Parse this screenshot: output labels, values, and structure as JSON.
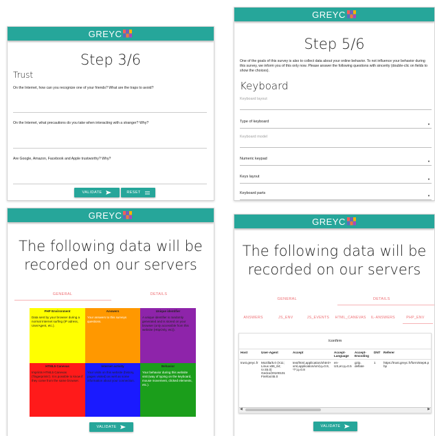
{
  "brand": {
    "name": "GREYC",
    "color": "#26a69a",
    "accent": "#ee6e73"
  },
  "p1": {
    "title": "Step 3/6",
    "section": "Trust",
    "q1": "On the Internet, how can you recognize one of your friends? What are the traps to avoid?",
    "q2": "On the Internet, what precautions do you take when interacting with a stranger? Why?",
    "q3": "Are Google, Amazon, Facebook and Apple trustworthy? Why?",
    "validate": "VALIDATE",
    "reset": "RESET"
  },
  "p2": {
    "title": "Step 5/6",
    "intro": "One of the goals of this survey is also to collect data about your online behavior. To not influence your behavior during this survey, we inform you of this only now. Please answer the following questions with sincerity (double-clic on fields to show the choices).",
    "section": "Keyboard",
    "f1": "Keyboard layout",
    "f2": "Type of keyboard",
    "f3": "Keyboard model",
    "f4": "Numeric keypad",
    "f5": "Keys layout",
    "f6": "Keyboard parts"
  },
  "p3": {
    "title_line1": "The following data will be",
    "title_line2": "recorded on our servers",
    "tab1": "GENERAL",
    "tab2": "DETAILS",
    "c1h": "PHP Environment",
    "c1t": "Data sent by your browser during a normal Internet surfing (IP adress, UserAgent, etc.).",
    "c2h": "Answers",
    "c2t": "Your answers to this surveys questions.",
    "c3h": "Unique identifier",
    "c3t": "A unique identifier is randomly generated and is stored on your browser (only accessible from this website (HttpOnly, etc)).",
    "c4h": "HTML5 Canevas",
    "c4t": "Imprints HTML5 Canevas ('fingerprints'). It is possible to know if they come from the same browser.",
    "c5h": "Internet activity",
    "c5t": "Your visits on this website (history, pages visited) as well as some information about your connection.",
    "c6h": "Behavior",
    "c6t": "Your behavior during this website visit (way of typing on the keyboard, mouse movement, clicked elements, etc.).",
    "validate": "VALIDATE"
  },
  "p4": {
    "title_line1": "The following data will be",
    "title_line2": "recorded on our servers",
    "tab1": "GENERAL",
    "tab2": "DETAILS",
    "sub": [
      "ANSWERS",
      "JS_ENV",
      "JS_EVENTS",
      "HTML_CANEVAS",
      "IL-ANSWERS",
      "PHP_ENV"
    ],
    "path": "/confirm",
    "cols": [
      "Host",
      "User-Agent",
      "Accept",
      "Accept-Language",
      "Accept-Encoding",
      "DNT",
      "Referer"
    ],
    "row": [
      "trust.greyc.fr",
      "Mozilla/5.0 (X11; Linux x86_64; rv:45.0) Gecko/20100101 Firefox/45.0",
      "text/html,application/xhtml+xml,application/xml;q=0.9,*/*;q=0.8",
      "en-US,en;q=0.5",
      "gzip, deflate",
      "1",
      "https://trust.greyc.fr/form/step6.php"
    ],
    "validate": "VALIDATE"
  }
}
